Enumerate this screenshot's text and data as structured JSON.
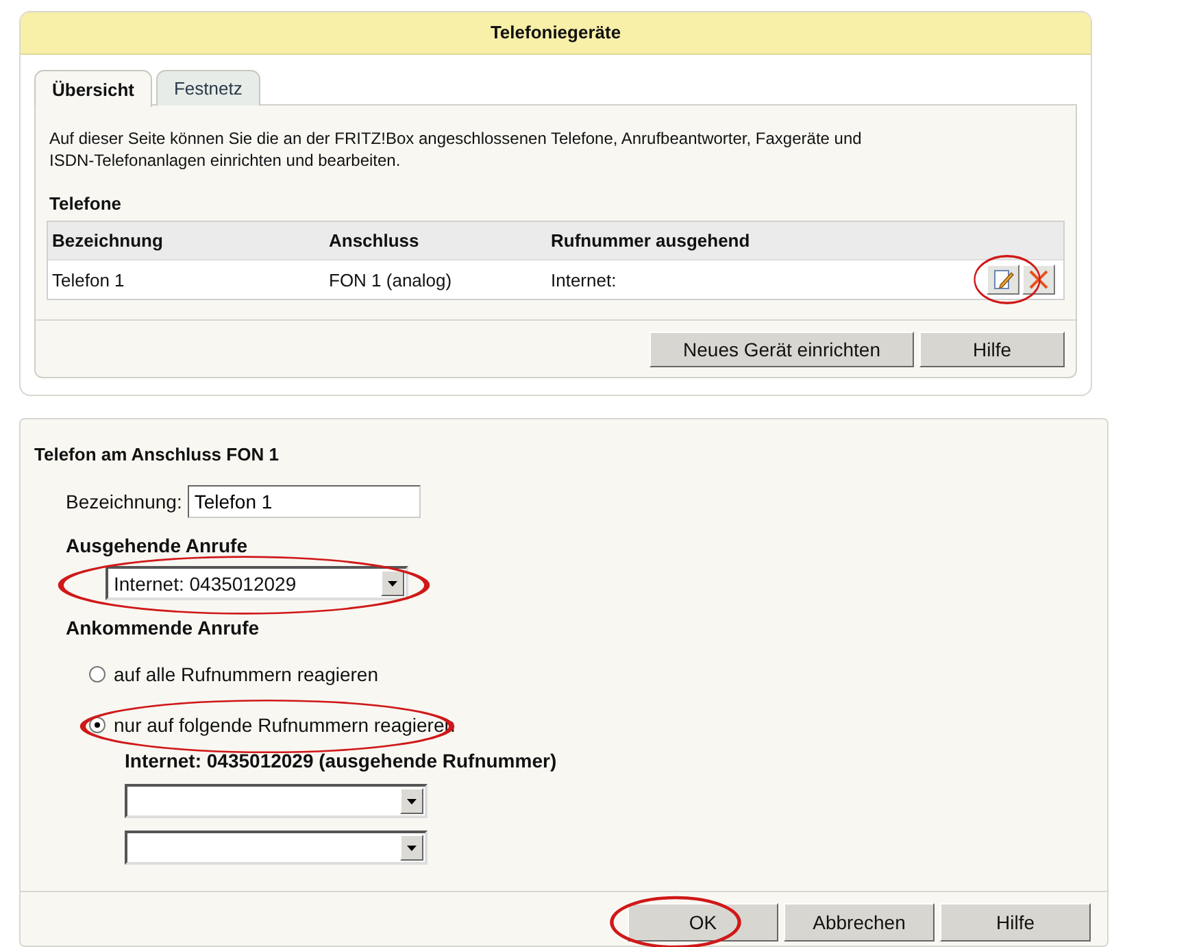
{
  "panel": {
    "title": "Telefoniegeräte",
    "tabs": [
      {
        "label": "Übersicht",
        "selected": true
      },
      {
        "label": "Festnetz",
        "selected": false
      }
    ],
    "description": "Auf dieser Seite können Sie die an der FRITZ!Box angeschlossenen Telefone, Anrufbeantworter, Faxgeräte und ISDN-Telefonanlagen einrichten und bearbeiten.",
    "section": "Telefone",
    "table": {
      "columns": [
        "Bezeichnung",
        "Anschluss",
        "Rufnummer ausgehend"
      ],
      "rows": [
        {
          "cells": [
            "Telefon 1",
            "FON 1 (analog)",
            "Internet:"
          ],
          "edit_highlighted": true
        }
      ]
    },
    "buttons": [
      {
        "label": "Neues Gerät einrichten",
        "highlighted": false
      },
      {
        "label": "Hilfe",
        "highlighted": false
      }
    ]
  },
  "form": {
    "title": "Telefon am Anschluss FON 1",
    "name_label": "Bezeichnung:",
    "name_value": "Telefon 1",
    "outgoing_heading": "Ausgehende Anrufe",
    "outgoing_select": {
      "value": "Internet: 0435012029",
      "highlighted": true
    },
    "incoming_heading": "Ankommende Anrufe",
    "radios": [
      {
        "label": "auf alle Rufnummern reagieren",
        "selected": false,
        "highlighted": false
      },
      {
        "label": "nur auf folgende Rufnummern reagieren",
        "selected": true,
        "highlighted": true
      }
    ],
    "fixed_number": "Internet: 0435012029 (ausgehende Rufnummer)",
    "number_selects": [
      {
        "kind": "dropdown"
      },
      {
        "kind": "dropdown"
      }
    ],
    "buttons": [
      {
        "label": "OK",
        "highlighted": true
      },
      {
        "label": "Abbrechen",
        "highlighted": false
      },
      {
        "label": "Hilfe",
        "highlighted": false
      }
    ]
  }
}
